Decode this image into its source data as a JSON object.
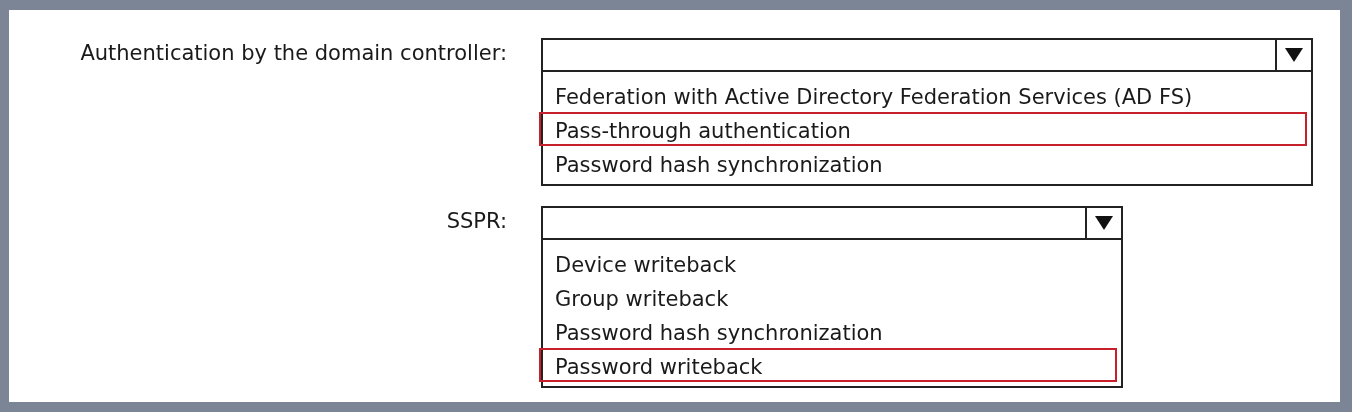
{
  "questions": [
    {
      "label": "Authentication by the domain controller:",
      "options": [
        {
          "label": "Federation with Active Directory Federation Services (AD FS)",
          "selected": false
        },
        {
          "label": "Pass-through authentication",
          "selected": true
        },
        {
          "label": "Password hash synchronization",
          "selected": false
        }
      ]
    },
    {
      "label": "SSPR:",
      "options": [
        {
          "label": "Device writeback",
          "selected": false
        },
        {
          "label": "Group writeback",
          "selected": false
        },
        {
          "label": "Password hash synchronization",
          "selected": false
        },
        {
          "label": "Password writeback",
          "selected": true
        }
      ]
    }
  ]
}
